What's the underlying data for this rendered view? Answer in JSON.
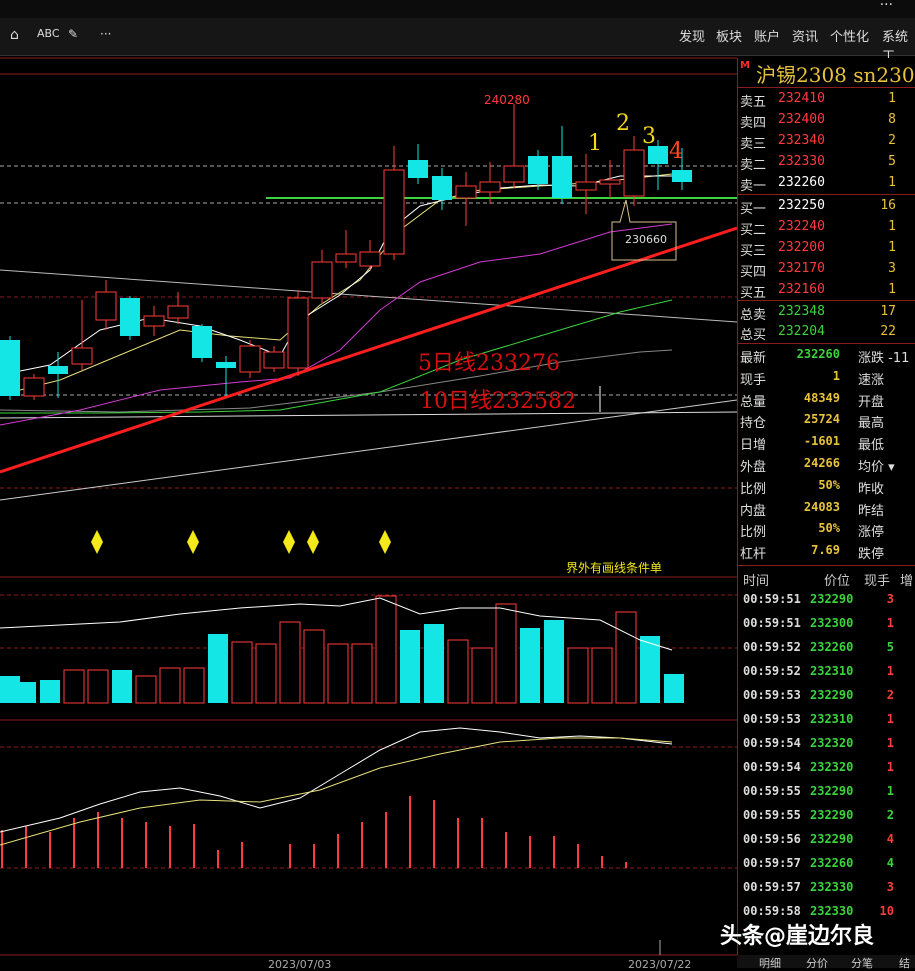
{
  "window": {
    "dots": "···"
  },
  "toolbar": {
    "icons": [
      "home-icon",
      "abc-icon",
      "pen-icon",
      "more-icon"
    ],
    "abc_label": "ABC",
    "more_label": "···",
    "menu": [
      "发现",
      "板块",
      "账户",
      "资讯",
      "个性化",
      "系统工"
    ]
  },
  "chart": {
    "annotations": {
      "peak_price": "240280",
      "low_price": "230660",
      "marks": [
        "1",
        "2",
        "3",
        "4"
      ],
      "ma5_label": "5日线233276",
      "ma10_label": "10日线232582",
      "cond_label": "界外有画线条件单"
    },
    "dates": [
      "2023/07/03",
      "2023/07/22"
    ],
    "colors": {
      "up": "#ff3b3b",
      "down": "#14e5e5",
      "ma5": "#ffffff",
      "ma10": "#f0e68c",
      "ma20": "#d43ad4",
      "trend": "#ff1e1e",
      "support": "#3cd33c"
    }
  },
  "quote": {
    "marker": "M",
    "title": "沪锡2308  sn230",
    "asks": [
      {
        "label": "卖五",
        "price": "232410",
        "qty": "1"
      },
      {
        "label": "卖四",
        "price": "232400",
        "qty": "8"
      },
      {
        "label": "卖三",
        "price": "232340",
        "qty": "2"
      },
      {
        "label": "卖二",
        "price": "232330",
        "qty": "5"
      },
      {
        "label": "卖一",
        "price": "232260",
        "qty": "1"
      }
    ],
    "bids": [
      {
        "label": "买一",
        "price": "232250",
        "qty": "16"
      },
      {
        "label": "买二",
        "price": "232240",
        "qty": "1"
      },
      {
        "label": "买三",
        "price": "232200",
        "qty": "1"
      },
      {
        "label": "买四",
        "price": "232170",
        "qty": "3"
      },
      {
        "label": "买五",
        "price": "232160",
        "qty": "1"
      }
    ],
    "totals": [
      {
        "label": "总卖",
        "price": "232348",
        "qty": "17"
      },
      {
        "label": "总买",
        "price": "232204",
        "qty": "22"
      }
    ],
    "stats": [
      {
        "l1": "最新",
        "v1": "232260",
        "c1": "#3cd33c",
        "l2": "涨跌 -11"
      },
      {
        "l1": "现手",
        "v1": "1",
        "c1": "#e8c23a",
        "l2": "速涨"
      },
      {
        "l1": "总量",
        "v1": "48349",
        "c1": "#e8c23a",
        "l2": "开盘"
      },
      {
        "l1": "持仓",
        "v1": "25724",
        "c1": "#e8c23a",
        "l2": "最高"
      },
      {
        "l1": "日增",
        "v1": "-1601",
        "c1": "#e8c23a",
        "l2": "最低"
      },
      {
        "l1": "外盘",
        "v1": "24266",
        "c1": "#e8c23a",
        "l2": "均价 ▾"
      },
      {
        "l1": "比例",
        "v1": "50%",
        "c1": "#e8c23a",
        "l2": "昨收"
      },
      {
        "l1": "内盘",
        "v1": "24083",
        "c1": "#e8c23a",
        "l2": "昨结"
      },
      {
        "l1": "比例",
        "v1": "50%",
        "c1": "#e8c23a",
        "l2": "涨停"
      },
      {
        "l1": "杠杆",
        "v1": "7.69",
        "c1": "#e8c23a",
        "l2": "跌停"
      }
    ],
    "trades_header": [
      "时间",
      "价位",
      "现手",
      "增"
    ],
    "trades": [
      {
        "time": "00:59:51",
        "price": "232290",
        "qty": "3",
        "color": "#ff3b3b"
      },
      {
        "time": "00:59:51",
        "price": "232300",
        "qty": "1",
        "color": "#ff3b3b"
      },
      {
        "time": "00:59:52",
        "price": "232260",
        "qty": "5",
        "color": "#3cd33c"
      },
      {
        "time": "00:59:52",
        "price": "232310",
        "qty": "1",
        "color": "#ff3b3b"
      },
      {
        "time": "00:59:53",
        "price": "232290",
        "qty": "2",
        "color": "#ff3b3b"
      },
      {
        "time": "00:59:53",
        "price": "232310",
        "qty": "1",
        "color": "#ff3b3b"
      },
      {
        "time": "00:59:54",
        "price": "232320",
        "qty": "1",
        "color": "#ff3b3b"
      },
      {
        "time": "00:59:54",
        "price": "232320",
        "qty": "1",
        "color": "#ff3b3b"
      },
      {
        "time": "00:59:55",
        "price": "232290",
        "qty": "1",
        "color": "#3cd33c"
      },
      {
        "time": "00:59:55",
        "price": "232290",
        "qty": "2",
        "color": "#3cd33c"
      },
      {
        "time": "00:59:56",
        "price": "232290",
        "qty": "4",
        "color": "#ff3b3b"
      },
      {
        "time": "00:59:57",
        "price": "232260",
        "qty": "4",
        "color": "#3cd33c"
      },
      {
        "time": "00:59:57",
        "price": "232330",
        "qty": "3",
        "color": "#ff3b3b"
      },
      {
        "time": "00:59:58",
        "price": "232330",
        "qty": "10",
        "color": "#ff3b3b"
      }
    ],
    "tabs": [
      "明细",
      "分价",
      "分笔",
      "结"
    ]
  },
  "watermark": "头条@崖边尔良"
}
